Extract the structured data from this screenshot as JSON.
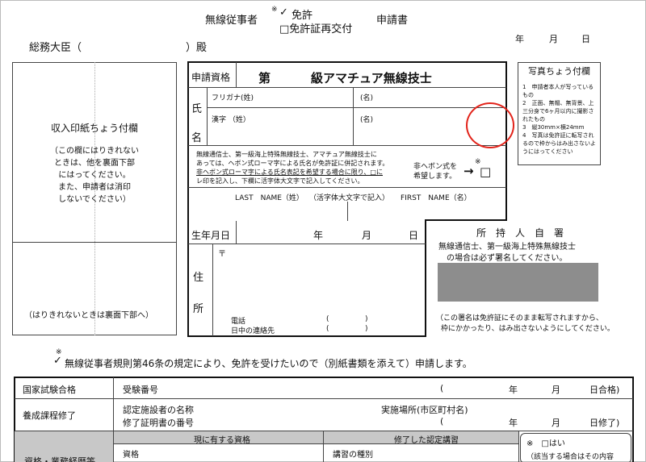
{
  "header": {
    "line1_prefix": "無線従事者",
    "asterisk": "※",
    "check_mark": "✓",
    "option_license": "免許",
    "option_reissue": "□免許証再交付",
    "suffix": "申請書",
    "addressee": "総務大臣（",
    "addressee_end": "）殿",
    "date_year": "年",
    "date_month": "月",
    "date_day": "日"
  },
  "stamp_box": {
    "title": "収入印紙ちょう付欄",
    "note_lines": [
      "（この欄にはりきれない",
      "ときは、他を裏面下部",
      "にはってください。",
      "また、申請者は消印",
      "しないでください）"
    ],
    "bottom_note": "（はりきれないときは裏面下部へ）"
  },
  "application": {
    "qualification_label": "申請資格",
    "qualification_prefix": "第",
    "qualification_suffix": "級アマチュア無線技士",
    "name_label_1": "氏",
    "name_label_2": "名",
    "furigana_label": "フリガナ(姓)",
    "furigana_given": "(名)",
    "kanji_label": "漢字 （姓）",
    "kanji_given": "(名)",
    "hepburn_note_lines": [
      "無線通信士、第一級海上特殊無線技士、アマチュア無線技士に",
      "あっては、ヘボン式ローマ字による氏名が免許証に併記されます。",
      "非ヘボン式ローマ字による氏名表記を希望する場合に限り、□に",
      "レ印を記入し、下欄に活字体大文字で記入してください。"
    ],
    "non_hepburn_label_1": "非ヘボン式を",
    "non_hepburn_label_2": "希望します。",
    "arrow": "→",
    "asterisk": "※",
    "checkbox": "□",
    "last_name_label": "LAST　NAME（姓）",
    "block_caps_note": "（活字体大文字で記入）",
    "first_name_label": "FIRST　NAME（名）",
    "birthdate_label": "生年月日",
    "birth_year": "年",
    "birth_month": "月",
    "birth_day": "日",
    "address_label_1": "住",
    "address_label_2": "所",
    "postal_mark": "〒",
    "phone_label": "電話",
    "daytime_contact_label": "日中の連絡先",
    "paren_open": "(",
    "paren_close": ")"
  },
  "photo_box": {
    "title": "写真ちょう付欄",
    "notes": [
      "1　申請者本人が写っているもの",
      "2　正面、無帽、無背景、上三分身で6ヶ月以内に撮影されたもの",
      "3　縦30mm×横24mm",
      "4　写真は免許証に転写されるので枠からはみ出さないようにはってください"
    ]
  },
  "signature": {
    "title": "所　持　人　自　署",
    "line1": "無線通信士、第一級海上特殊無線技士",
    "line2": "の場合は必ず署名してください。",
    "note1": "（この署名は免許証にそのまま転写されますから、",
    "note2": "枠にかかったり、はみ出さないようにしてください。"
  },
  "declaration": {
    "check_mark": "✓",
    "asterisk": "※",
    "text": "無線従事者規則第46条の規定により、免許を受けたいので（別紙書類を添えて）申請します。"
  },
  "table": {
    "exam_pass_label": "国家試験合格",
    "exam_number_label": "受験番号",
    "exam_paren": "(",
    "exam_year": "年",
    "exam_month": "月",
    "exam_day_pass": "日合格)",
    "course_label": "養成課程修了",
    "facility_name_label": "認定施設者の名称",
    "venue_label": "実施場所(市区町村名)",
    "cert_number_label": "修了証明書の番号",
    "course_paren": "(",
    "course_year": "年",
    "course_month": "月",
    "course_day_done": "日修了)",
    "current_qual_header": "現に有する資格",
    "completed_course_header": "修了した認定講習",
    "qualification_col": "資格",
    "course_type_col": "講習の種別",
    "row_label_partial": "資格・業務経歴等",
    "yes_label": "※　□はい",
    "yes_note": "（該当する場合はその内容"
  }
}
